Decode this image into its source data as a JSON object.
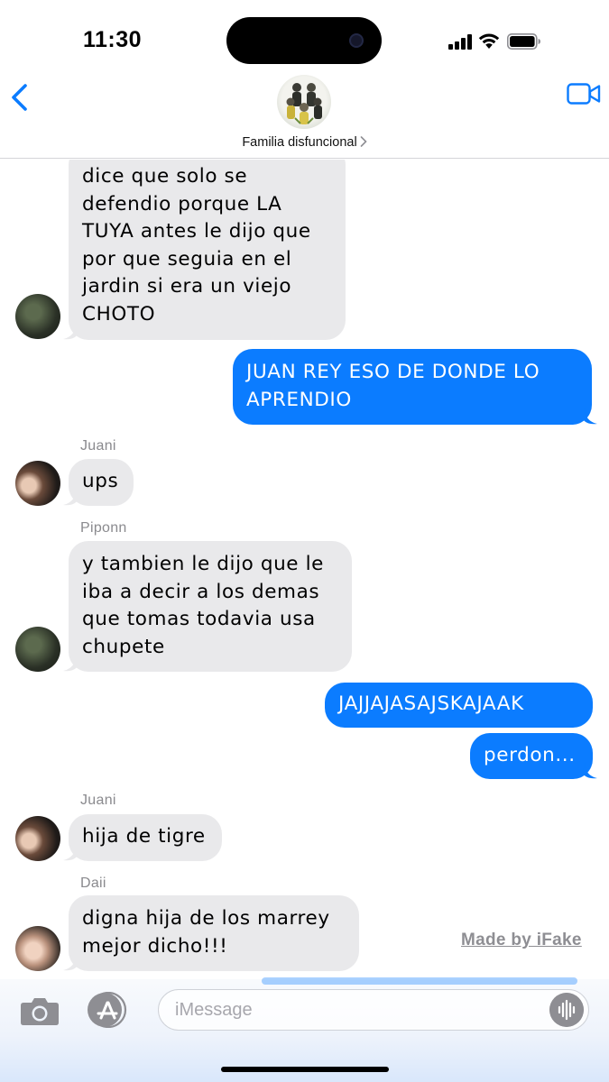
{
  "status_bar": {
    "time": "11:30"
  },
  "header": {
    "group_name": "Familia disfuncional"
  },
  "messages": [
    {
      "type": "in",
      "sender": "",
      "text": "dice que solo se\ndefendio porque LA\nTUYA antes le dijo que\npor que seguia en el\njardin si era un viejo\nCHOTO"
    },
    {
      "type": "out",
      "text": "JUAN REY ESO DE DONDE LO\nAPRENDIO"
    },
    {
      "type": "in",
      "sender": "Juani",
      "text": "ups"
    },
    {
      "type": "in",
      "sender": "Piponn",
      "text": "y tambien le dijo que le\niba a decir a los demas\nque tomas todavia usa\nchupete"
    },
    {
      "type": "out",
      "text": "JAJJAJASAJSKAJAAK"
    },
    {
      "type": "out",
      "text": "perdon..."
    },
    {
      "type": "in",
      "sender": "Juani",
      "text": "hija de tigre"
    },
    {
      "type": "in",
      "sender": "Daii",
      "text": "digna hija de los marrey\nmejor dicho!!!"
    }
  ],
  "watermark": "Made by iFake",
  "input": {
    "placeholder": "iMessage"
  },
  "colors": {
    "accent": "#0b7cff",
    "incoming_bubble": "#e9e9eb",
    "sender_label": "#8a8a8e"
  }
}
